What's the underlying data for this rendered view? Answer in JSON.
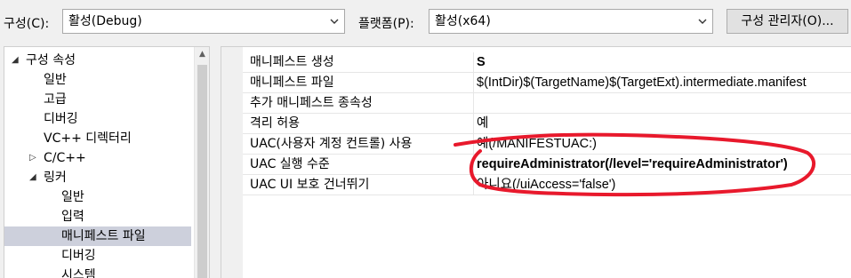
{
  "toolbar": {
    "config_label": "구성(C):",
    "config_value": "활성(Debug)",
    "platform_label": "플랫폼(P):",
    "platform_value": "활성(x64)",
    "manager_button": "구성 관리자(O)..."
  },
  "tree": {
    "root": {
      "label": "구성 속성",
      "expander": "◢"
    },
    "items": [
      {
        "label": "일반"
      },
      {
        "label": "고급"
      },
      {
        "label": "디버깅"
      },
      {
        "label": "VC++ 디렉터리"
      },
      {
        "label": "C/C++",
        "expander": "▷"
      },
      {
        "label": "링커",
        "expander": "◢"
      },
      {
        "label": "일반"
      },
      {
        "label": "입력"
      },
      {
        "label": "매니페스트 파일",
        "selected": true
      },
      {
        "label": "디버깅"
      },
      {
        "label": "시스템"
      }
    ],
    "scroll_up": "▲"
  },
  "properties": [
    {
      "name": "매니페스트 생성",
      "value": "S"
    },
    {
      "name": "매니페스트 파일",
      "value": "$(IntDir)$(TargetName)$(TargetExt).intermediate.manifest"
    },
    {
      "name": "추가 매니페스트 종속성",
      "value": ""
    },
    {
      "name": "격리 허용",
      "value": "예"
    },
    {
      "name": "UAC(사용자 계정 컨트롤) 사용",
      "value": "예(/MANIFESTUAC:)"
    },
    {
      "name": "UAC 실행 수준",
      "value": "requireAdministrator(/level='requireAdministrator')"
    },
    {
      "name": "UAC UI 보호 건너뛰기",
      "value": "아니요(/uiAccess='false')"
    }
  ],
  "colors": {
    "annotation_red": "#e8192c",
    "selected_bg": "#cdd0dc"
  }
}
